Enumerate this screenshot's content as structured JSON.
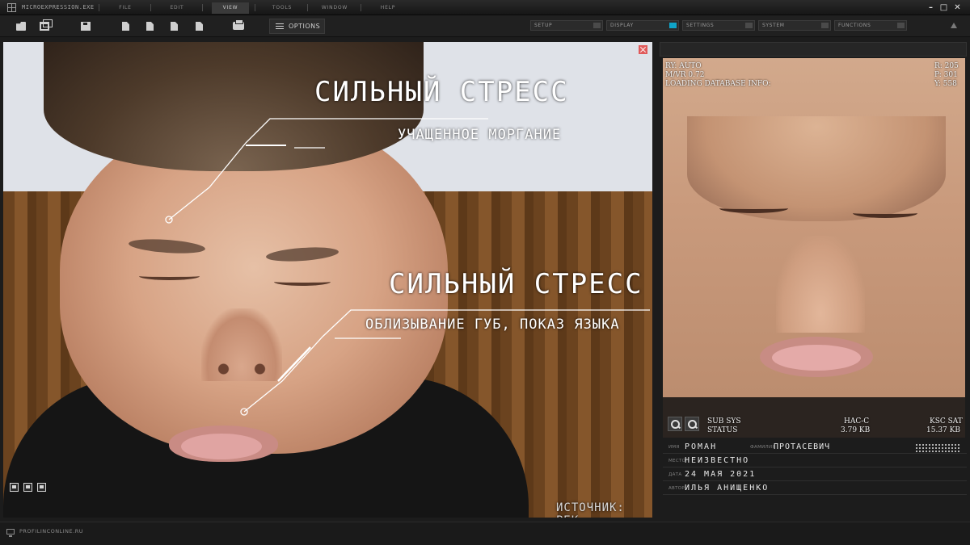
{
  "app": {
    "title": "MICROEXPRESSION.EXE"
  },
  "menu": [
    "FILE",
    "EDIT",
    "VIEW",
    "TOOLS",
    "WINDOW",
    "HELP"
  ],
  "menu_active": "VIEW",
  "window_controls": {
    "minimize": "–",
    "maximize": "□",
    "close": "✕"
  },
  "toolbar": {
    "options_label": "OPTIONS",
    "segments": [
      {
        "label": "SETUP",
        "active": false
      },
      {
        "label": "DISPLAY",
        "active": true
      },
      {
        "label": "SETTINGS",
        "active": false
      },
      {
        "label": "SYSTEM",
        "active": false
      },
      {
        "label": "FUNCTIONS",
        "active": false
      }
    ]
  },
  "video": {
    "caption1_title": "СИЛЬНЫЙ СТРЕСС",
    "caption1_sub": "УЧАЩЕННОЕ МОРГАНИЕ",
    "caption2_title": "СИЛЬНЫЙ СТРЕСС",
    "caption2_sub": "ОБЛИЗЫВАНИЕ ГУБ, ПОКАЗ ЯЗЫКА",
    "source": "ИСТОЧНИК: РБК"
  },
  "analysis": {
    "ry": "RY: AUTO",
    "mvr": "M/VR 0.72",
    "loading": "LOADING DATABASE INFO:",
    "r": "R: 205",
    "p": "P: 301",
    "y": "Y: 558",
    "sub_sys": "SUB SYS",
    "status": "STATUS",
    "hac_label": "HAC-C",
    "hac_size": "3.79 KB",
    "ksc_label": "KSC SAT",
    "ksc_size": "15.37 KB"
  },
  "profile": {
    "name_key": "ИМЯ",
    "name_value": "РОМАН",
    "surname_key": "ФАМИЛИЯ",
    "surname_value": "ПРОТАСЕВИЧ",
    "place_key": "МЕСТО",
    "place_value": "НЕИЗВЕСТНО",
    "date_key": "ДАТА",
    "date_value": "24 МАЯ 2021",
    "author_key": "АВТОР",
    "author_value": "ИЛЬЯ АНИЩЕНКО"
  },
  "statusbar": {
    "text": "PROFILINCONLINE.RU"
  },
  "colors": {
    "accent": "#0fa4c8",
    "close": "#e05a5a"
  }
}
